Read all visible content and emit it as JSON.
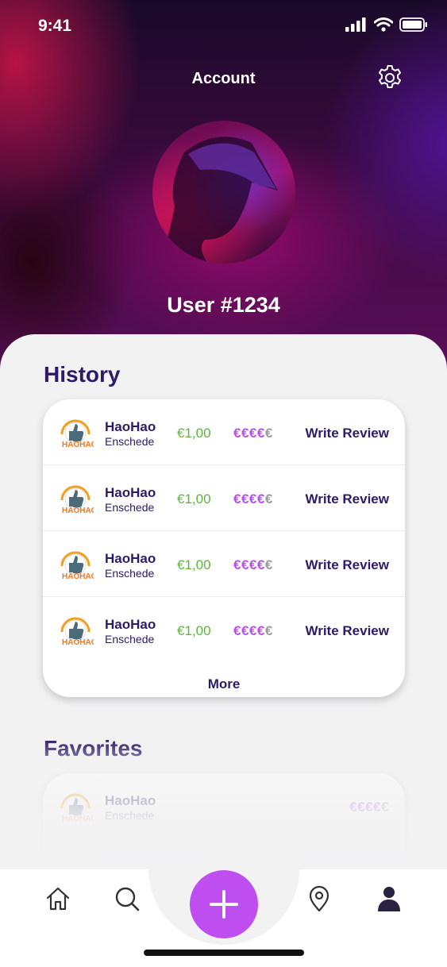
{
  "status_bar": {
    "time": "9:41"
  },
  "header": {
    "title": "Account"
  },
  "profile": {
    "username": "User #1234"
  },
  "history": {
    "title": "History",
    "items": [
      {
        "name": "HaoHao",
        "city": "Enschede",
        "price": "€1,00",
        "price_level_active": "€€€€",
        "price_level_inactive": "€",
        "action": "Write Review"
      },
      {
        "name": "HaoHao",
        "city": "Enschede",
        "price": "€1,00",
        "price_level_active": "€€€€",
        "price_level_inactive": "€",
        "action": "Write Review"
      },
      {
        "name": "HaoHao",
        "city": "Enschede",
        "price": "€1,00",
        "price_level_active": "€€€€",
        "price_level_inactive": "€",
        "action": "Write Review"
      },
      {
        "name": "HaoHao",
        "city": "Enschede",
        "price": "€1,00",
        "price_level_active": "€€€€",
        "price_level_inactive": "€",
        "action": "Write Review"
      }
    ],
    "more_label": "More"
  },
  "favorites": {
    "title": "Favorites",
    "items": [
      {
        "name": "HaoHao",
        "city": "Enschede",
        "price_level_active": "€€€€",
        "price_level_inactive": "€"
      }
    ]
  },
  "tabbar": {
    "items": [
      "home-icon",
      "search-icon",
      "add-icon",
      "location-pin-icon",
      "profile-icon"
    ],
    "active": "profile-icon"
  },
  "colors": {
    "brand_dark": "#2e1a6b",
    "accent_purple": "#bf4ef0",
    "price_green": "#5fb53a",
    "price_level": "#b94ee6"
  }
}
